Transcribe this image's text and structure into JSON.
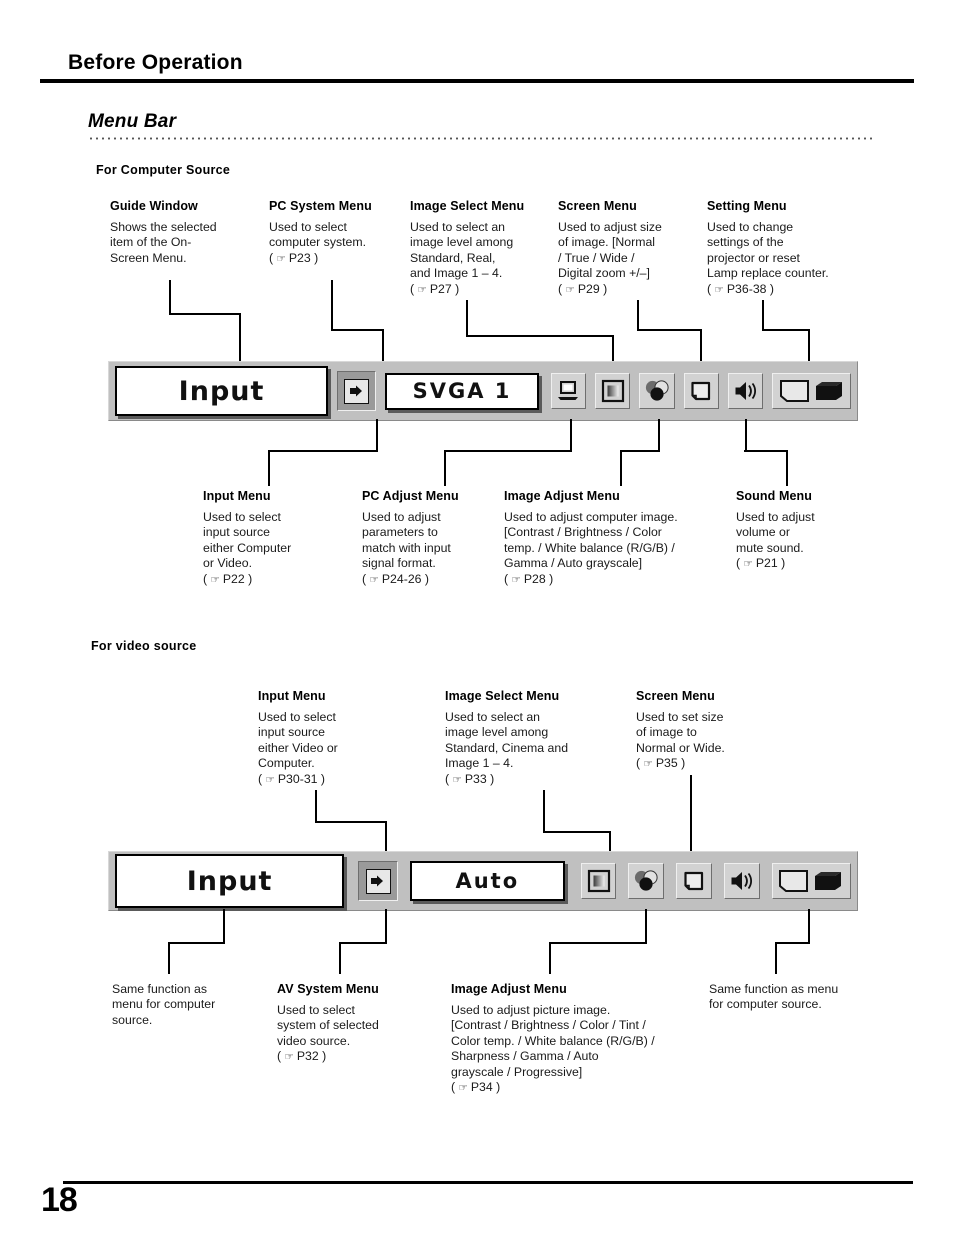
{
  "header": {
    "title": "Before Operation"
  },
  "section": {
    "title": "Menu Bar"
  },
  "subheads": {
    "computer": "For  Computer  Source",
    "video": "For video source"
  },
  "computer_top_annotations": [
    {
      "title": "Guide Window",
      "lines": [
        "Shows the selected",
        "item of the On-",
        "Screen Menu."
      ],
      "ref": ""
    },
    {
      "title": "PC System Menu",
      "lines": [
        "Used to select",
        "computer system."
      ],
      "ref": "P23"
    },
    {
      "title": "Image Select Menu",
      "lines": [
        "Used to select  an",
        "image level among",
        "Standard, Real,",
        "and Image 1 – 4."
      ],
      "ref": "P27"
    },
    {
      "title": "Screen Menu",
      "lines": [
        "Used to adjust size",
        "of image.  [Normal",
        "/ True / Wide /",
        "Digital zoom +/–]"
      ],
      "ref": "P29"
    },
    {
      "title": "Setting Menu",
      "lines": [
        "Used to change",
        "settings of the",
        "projector or reset",
        "Lamp replace counter."
      ],
      "ref": "P36-38"
    }
  ],
  "computer_bottom_annotations": [
    {
      "title": "Input Menu",
      "lines": [
        "Used to select",
        "input source",
        "either Computer",
        "or Video."
      ],
      "ref": "P22"
    },
    {
      "title": "PC Adjust Menu",
      "lines": [
        "Used to adjust",
        "parameters to",
        "match with input",
        "signal format."
      ],
      "ref": "P24-26"
    },
    {
      "title": "Image Adjust Menu",
      "lines": [
        "Used to adjust computer image.",
        "[Contrast / Brightness / Color",
        "temp. /  White balance (R/G/B)  /",
        "Gamma / Auto grayscale]"
      ],
      "ref": "P28"
    },
    {
      "title": "Sound Menu",
      "lines": [
        "Used to adjust",
        "volume or",
        "mute sound."
      ],
      "ref": "P21"
    }
  ],
  "video_top_annotations": [
    {
      "title": "Input Menu",
      "lines": [
        "Used to select",
        "input source",
        "either Video or",
        "Computer."
      ],
      "ref": "P30-31"
    },
    {
      "title": "Image Select Menu",
      "lines": [
        "Used to select an",
        "image level among",
        "Standard, Cinema and",
        "Image 1 – 4."
      ],
      "ref": "P33"
    },
    {
      "title": "Screen Menu",
      "lines": [
        "Used to set size",
        "of image to",
        "Normal or Wide."
      ],
      "ref": "P35"
    }
  ],
  "video_bottom_annotations": [
    {
      "title": "",
      "lines": [
        "Same function as",
        "menu for computer",
        "source."
      ],
      "ref": ""
    },
    {
      "title": "AV System Menu",
      "lines": [
        "Used to select",
        "system of selected",
        "video source."
      ],
      "ref": "P32"
    },
    {
      "title": "Image Adjust Menu",
      "lines": [
        " Used to adjust picture image.",
        "[Contrast / Brightness / Color / Tint /",
        "Color temp. / White balance (R/G/B) /",
        "Sharpness /  Gamma / Auto",
        "grayscale / Progressive]"
      ],
      "ref": "P34"
    },
    {
      "title": "",
      "lines": [
        "Same function as menu",
        "for computer source."
      ],
      "ref": ""
    }
  ],
  "computer_menubar": {
    "guide_window_label": "Input",
    "value_window_label": "SVGA 1",
    "icons": [
      {
        "name": "input-arrow-icon",
        "selected": true
      },
      {
        "name": "pc-system-laptop-icon",
        "selected": false
      },
      {
        "name": "image-select-square-icon",
        "selected": false
      },
      {
        "name": "image-adjust-palette-icon",
        "selected": false
      },
      {
        "name": "screen-icon",
        "selected": false
      },
      {
        "name": "sound-speaker-icon",
        "selected": false
      },
      {
        "name": "setting-projector-icon",
        "selected": false
      }
    ]
  },
  "video_menubar": {
    "guide_window_label": "Input",
    "value_window_label": "Auto",
    "icons": [
      {
        "name": "input-arrow-icon",
        "selected": true
      },
      {
        "name": "image-select-square-icon",
        "selected": false
      },
      {
        "name": "image-adjust-palette-icon",
        "selected": false
      },
      {
        "name": "screen-icon",
        "selected": false
      },
      {
        "name": "sound-speaker-icon",
        "selected": false
      },
      {
        "name": "setting-projector-icon",
        "selected": false
      }
    ]
  },
  "footer": {
    "page_number": "18"
  },
  "colors": {
    "menubar_face": "#c0c0c0",
    "button_face": "#d2d2d2",
    "selected_face": "#9a9a9a",
    "window_face": "#ffffff",
    "ink": "#000000"
  }
}
